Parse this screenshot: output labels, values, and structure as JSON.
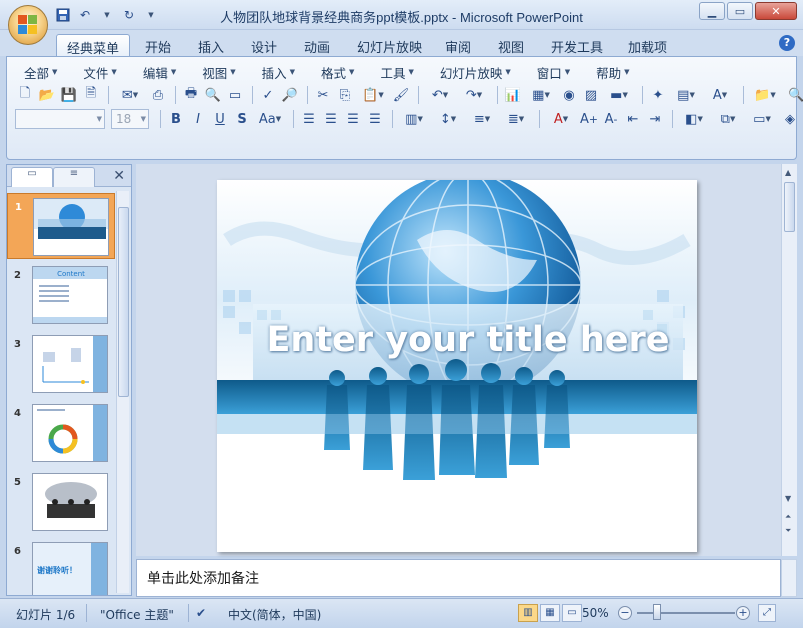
{
  "window": {
    "title": "人物团队地球背景经典商务ppt模板.pptx - Microsoft PowerPoint",
    "minimize_icon": "minimize-icon",
    "maximize_icon": "maximize-icon",
    "close_icon": "close-icon"
  },
  "ribbon_tabs": [
    "经典菜单",
    "开始",
    "插入",
    "设计",
    "动画",
    "幻灯片放映",
    "审阅",
    "视图",
    "开发工具",
    "加载项"
  ],
  "active_tab": "经典菜单",
  "menus": [
    "全部",
    "文件",
    "编辑",
    "视图",
    "插入",
    "格式",
    "工具",
    "幻灯片放映",
    "窗口",
    "帮助"
  ],
  "font": {
    "name_value": "",
    "size_value": "18"
  },
  "slide_thumbnails": [
    {
      "num": "1",
      "label": ""
    },
    {
      "num": "2",
      "label": "Content"
    },
    {
      "num": "3",
      "label": ""
    },
    {
      "num": "4",
      "label": ""
    },
    {
      "num": "5",
      "label": ""
    },
    {
      "num": "6",
      "label": "谢谢聆听！"
    }
  ],
  "slide": {
    "title": "Enter your title here"
  },
  "notes": {
    "placeholder": "单击此处添加备注"
  },
  "status": {
    "slide_info": "幻灯片 1/6",
    "theme": "\"Office 主题\"",
    "language": "中文(简体，中国)",
    "zoom": "50%"
  },
  "colors": {
    "accent": "#1e78c8",
    "selected_thumb": "#f3a657"
  }
}
